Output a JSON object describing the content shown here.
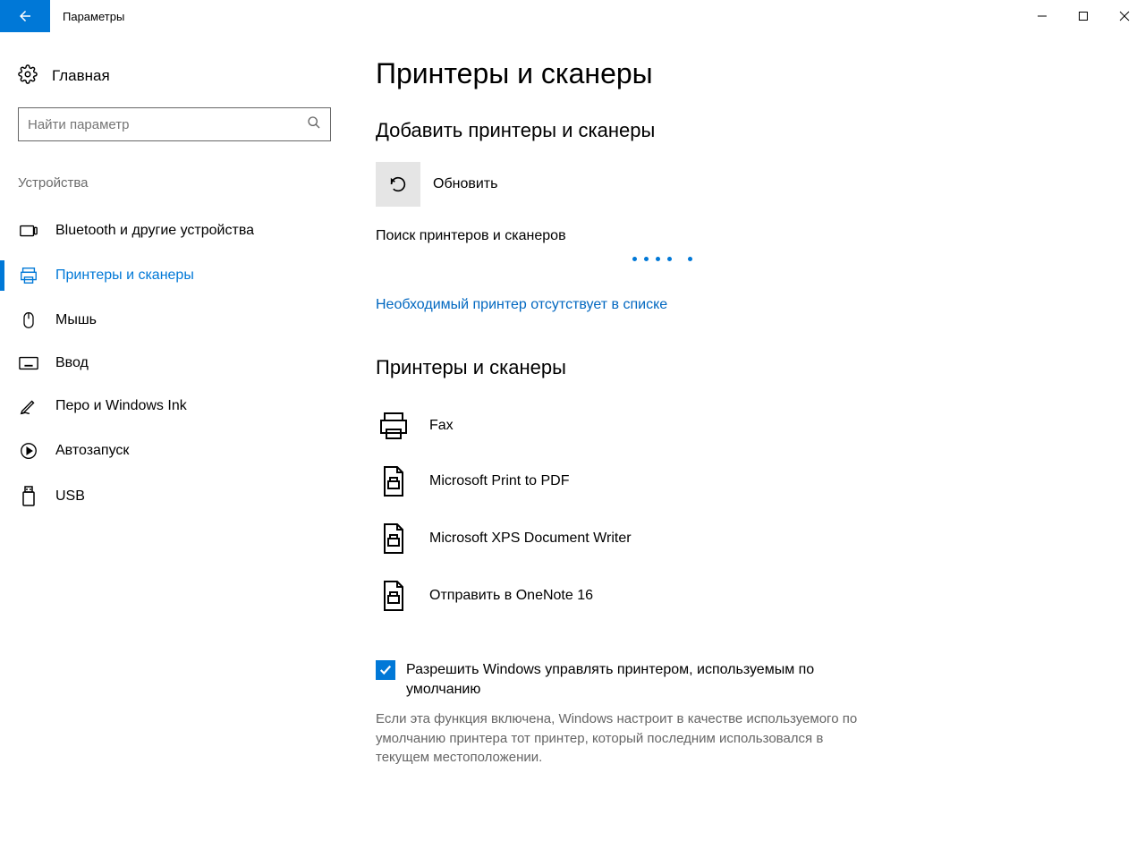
{
  "window": {
    "title": "Параметры"
  },
  "sidebar": {
    "home": "Главная",
    "search_placeholder": "Найти параметр",
    "section": "Устройства",
    "items": [
      {
        "label": "Bluetooth и другие устройства"
      },
      {
        "label": "Принтеры и сканеры"
      },
      {
        "label": "Мышь"
      },
      {
        "label": "Ввод"
      },
      {
        "label": "Перо и Windows Ink"
      },
      {
        "label": "Автозапуск"
      },
      {
        "label": "USB"
      }
    ]
  },
  "main": {
    "title": "Принтеры и сканеры",
    "add_section": "Добавить принтеры и сканеры",
    "refresh": "Обновить",
    "search_status": "Поиск принтеров и сканеров",
    "missing_link": "Необходимый принтер отсутствует в списке",
    "list_section": "Принтеры и сканеры",
    "printers": [
      {
        "label": "Fax"
      },
      {
        "label": "Microsoft Print to PDF"
      },
      {
        "label": "Microsoft XPS Document Writer"
      },
      {
        "label": "Отправить в OneNote 16"
      }
    ],
    "checkbox_label": "Разрешить Windows управлять принтером, используемым по умолчанию",
    "checkbox_desc": "Если эта функция включена, Windows настроит в качестве используемого по умолчанию принтера тот принтер, который последним использовался в текущем местоположении."
  }
}
